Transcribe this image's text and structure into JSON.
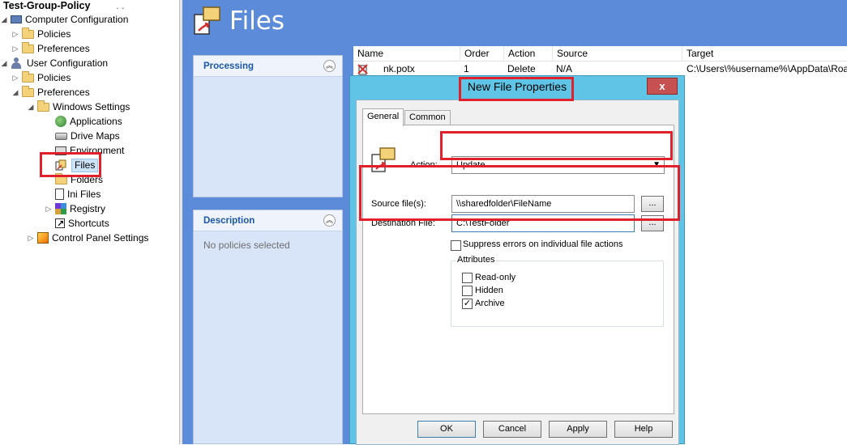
{
  "tree": {
    "root": "Test-Group-Policy",
    "items": [
      {
        "label": "Computer Configuration"
      },
      {
        "label": "Policies"
      },
      {
        "label": "Preferences"
      },
      {
        "label": "User Configuration"
      },
      {
        "label": "Policies"
      },
      {
        "label": "Preferences"
      },
      {
        "label": "Windows Settings"
      },
      {
        "label": "Applications"
      },
      {
        "label": "Drive Maps"
      },
      {
        "label": "Environment"
      },
      {
        "label": "Files"
      },
      {
        "label": "Folders"
      },
      {
        "label": "Ini Files"
      },
      {
        "label": "Registry"
      },
      {
        "label": "Shortcuts"
      },
      {
        "label": "Control Panel Settings"
      }
    ]
  },
  "main": {
    "title": "Files",
    "processing_title": "Processing",
    "description_title": "Description",
    "description_text": "No policies selected"
  },
  "list": {
    "columns": [
      "Name",
      "Order",
      "Action",
      "Source",
      "Target"
    ],
    "rows": [
      {
        "name": "nk.potx",
        "order": "1",
        "action": "Delete",
        "source": "N/A",
        "target": "C:\\Users\\%username%\\AppData\\Roa"
      }
    ]
  },
  "dialog": {
    "title": "New File Properties",
    "close": "x",
    "tabs": [
      "General",
      "Common"
    ],
    "action_label": "Action:",
    "action_value": "Update",
    "source_label": "Source file(s):",
    "source_value": "\\\\sharedfolder\\FileName",
    "dest_label": "Destination File:",
    "dest_value": "C:\\TestFolder",
    "browse": "...",
    "suppress_label": "Suppress errors on individual file actions",
    "attributes_title": "Attributes",
    "attributes": [
      {
        "label": "Read-only",
        "checked": false
      },
      {
        "label": "Hidden",
        "checked": false
      },
      {
        "label": "Archive",
        "checked": true
      }
    ],
    "buttons": {
      "ok": "OK",
      "cancel": "Cancel",
      "apply": "Apply",
      "help": "Help"
    }
  }
}
